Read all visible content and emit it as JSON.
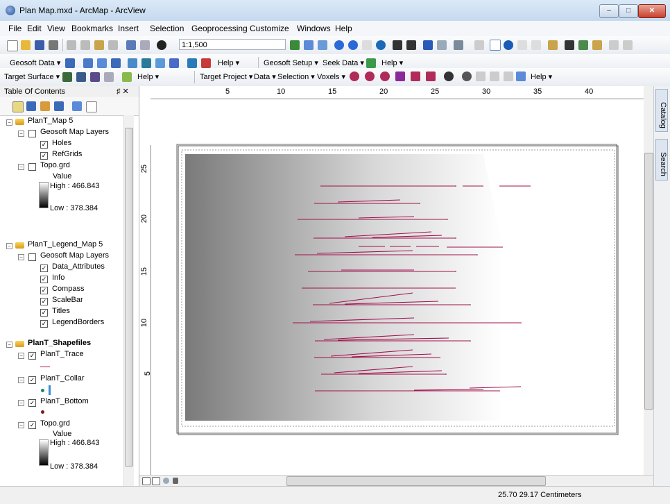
{
  "window": {
    "title": "Plan Map.mxd - ArcMap - ArcView",
    "min_label": "–",
    "max_label": "□",
    "close_label": "✕"
  },
  "menu": [
    "File",
    "Edit",
    "View",
    "Bookmarks",
    "Insert",
    "Selection",
    "Geoprocessing",
    "Customize",
    "Windows",
    "Help"
  ],
  "toolbar1": {
    "scale": "1:1,500"
  },
  "toolbar2": {
    "geosoft_data": "Geosoft Data ▾",
    "help1": "Help ▾",
    "geosoft_setup": "Geosoft Setup ▾",
    "seek_data": "Seek Data ▾",
    "help2": "Help ▾"
  },
  "toolbar3": {
    "target_surface": "Target Surface ▾",
    "help1": "Help ▾",
    "target_project": "Target Project ▾",
    "data": "Data ▾",
    "selection": "Selection ▾",
    "voxels": "Voxels ▾",
    "help2": "Help ▾"
  },
  "toc": {
    "title": "Table Of Contents",
    "pin": "♯ ✕",
    "rows": {
      "map5": "PlanT_Map 5",
      "geo_layers1": "Geosoft Map Layers",
      "holes": "Holes",
      "refgrids": "RefGrids",
      "topo1": "Topo.grd",
      "value1": "Value",
      "high1": "High : 466.843",
      "low1": "Low : 378.384",
      "legend_map5": "PlanT_Legend_Map 5",
      "geo_layers2": "Geosoft Map Layers",
      "data_attr": "Data_Attributes",
      "info": "Info",
      "compass": "Compass",
      "scalebar": "ScaleBar",
      "titles": "Titles",
      "legend_borders": "LegendBorders",
      "shapefiles": "PlanT_Shapefiles",
      "trace": "PlanT_Trace",
      "collar": "PlanT_Collar",
      "bottom": "PlanT_Bottom",
      "topo2": "Topo.grd",
      "value2": "Value",
      "high2": "High : 466.843",
      "low2": "Low : 378.384"
    }
  },
  "ruler": {
    "h": [
      "5",
      "10",
      "15",
      "20",
      "25",
      "30",
      "35",
      "40"
    ],
    "v": [
      "25",
      "20",
      "15",
      "10",
      "5"
    ]
  },
  "side_tabs": [
    "Catalog",
    "Search"
  ],
  "status": {
    "coords": "25.70  29.17 Centimeters"
  },
  "colors": {
    "trace": "#a0104a",
    "collar": "#1a8a5a",
    "bottom": "#7a1a1a"
  }
}
